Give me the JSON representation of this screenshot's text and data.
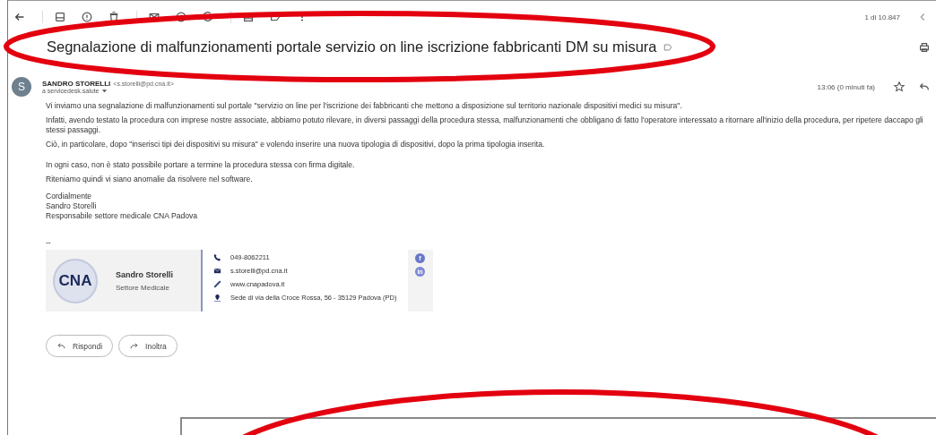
{
  "toolbar": {
    "counter": "1 di 10.847"
  },
  "subject": "Segnalazione di malfunzionamenti portale servizio on line iscrizione fabbricanti DM su misura",
  "message": {
    "avatar": "S",
    "sender": "SANDRO STORELLI",
    "sender_email": "<s.storelli@pd.cna.it>",
    "recipient": "a servicedesk.salute",
    "time": "13:06 (0 minuti fa)",
    "starred": false,
    "paragraphs": [
      "Vi inviamo una segnalazione di malfunzionamenti sul portale \"servizio on line per l'iscrizione dei fabbricanti che mettono a disposizione sul territorio nazionale dispositivi medici su misura\".",
      "Infatti, avendo testato la procedura con imprese nostre associate, abbiamo potuto rilevare, in diversi passaggi della procedura stessa, malfunzionamenti che obbligano di fatto l'operatore interessato a ritornare all'inizio della procedura, per ripetere daccapo gli stessi passaggi.",
      "Ciò, in particolare, dopo \"inserisci tipi dei dispositivi su misura\" e volendo inserire una nuova tipologia di dispositivi, dopo la prima tipologia inserita.",
      "In ogni caso, non è stato possibile portare a termine la procedura stessa con firma digitale.",
      "Riteniamo quindi vi siano anomalie da risolvere nel software."
    ],
    "closing": [
      "Cordialmente",
      "Sandro Storelli",
      "Responsabile settore medicale CNA Padova"
    ],
    "separator": "--"
  },
  "signature": {
    "logo": "CNA",
    "name": "Sandro Storelli",
    "role": "Settore Medicale",
    "contacts": [
      {
        "kind": "phone",
        "text": "049-8062211"
      },
      {
        "kind": "mail",
        "text": "s.storelli@pd.cna.it"
      },
      {
        "kind": "link",
        "text": "www.cnapadova.it"
      },
      {
        "kind": "place",
        "text": "Sede di via della Croce Rossa, 56 - 35129 Padova (PD)"
      }
    ],
    "social": [
      {
        "kind": "facebook",
        "label": "f"
      },
      {
        "kind": "linkedin",
        "label": "in"
      }
    ]
  },
  "actions": [
    {
      "kind": "reply",
      "label": "Rispondi"
    },
    {
      "kind": "forward",
      "label": "Inoltra"
    }
  ]
}
